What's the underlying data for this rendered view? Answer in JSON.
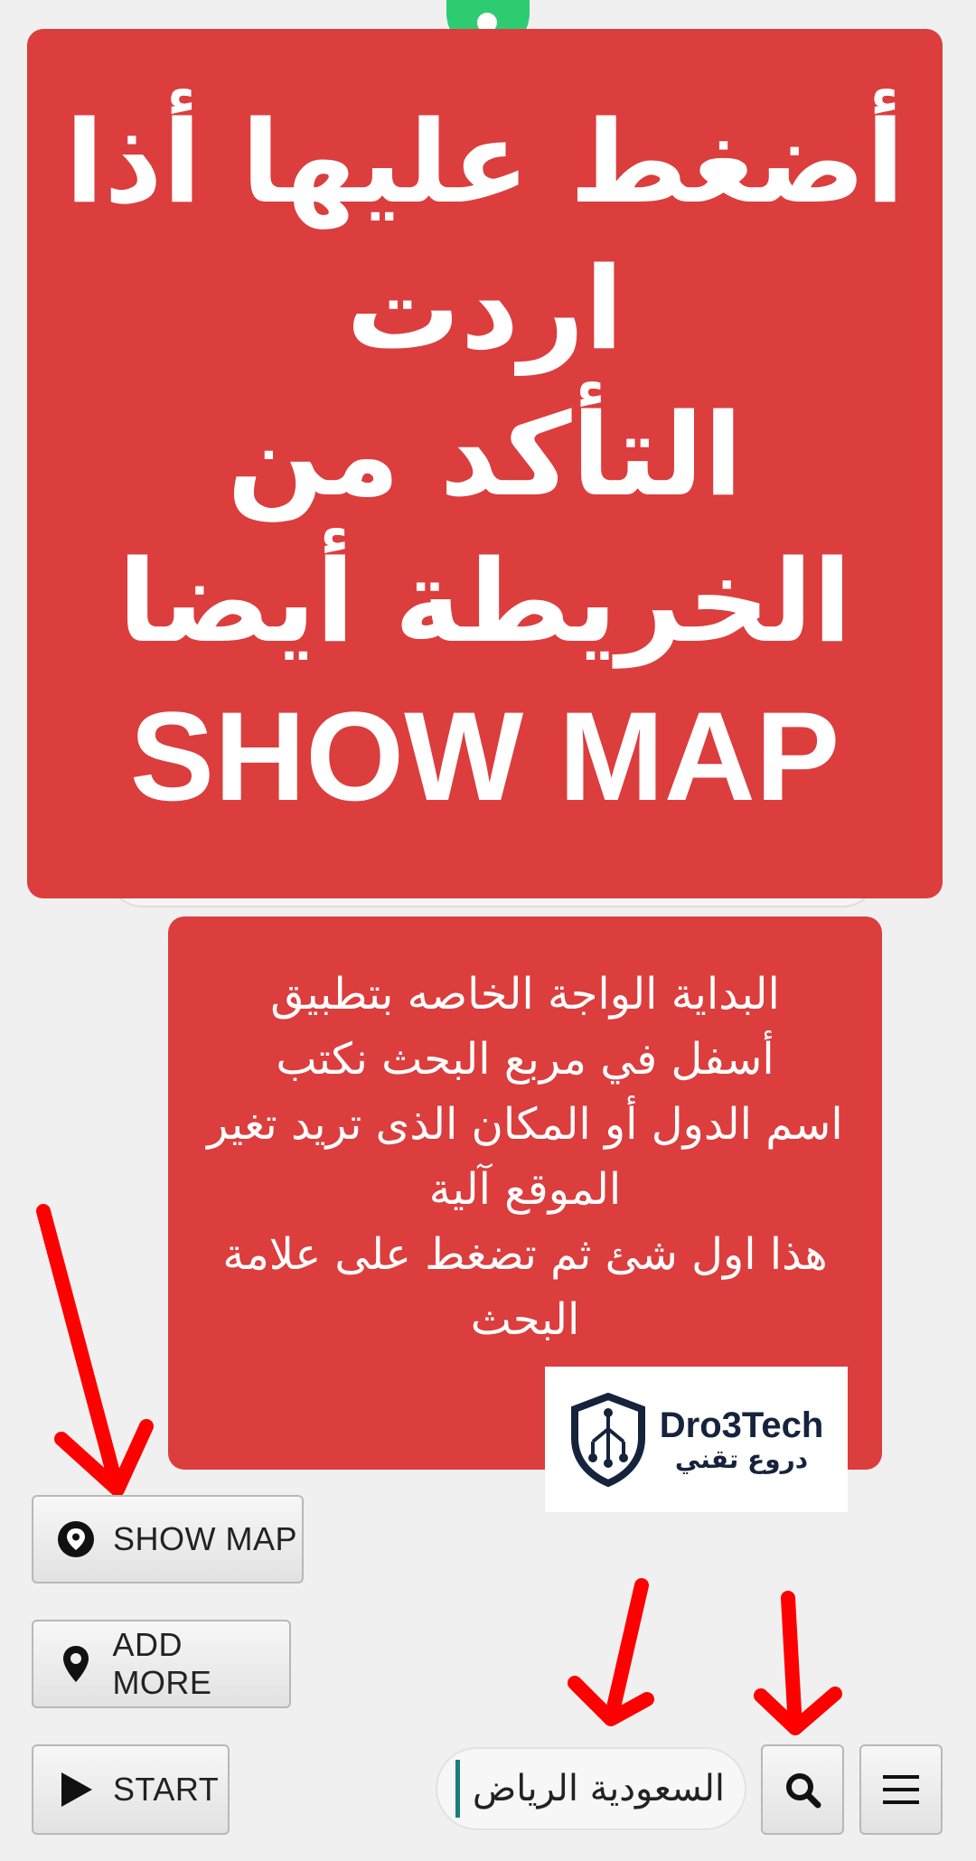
{
  "callout_top": {
    "lines": [
      "أضغط عليها أذا",
      "اردت",
      "التأكد من",
      "الخريطة أيضا",
      "SHOW MAP"
    ]
  },
  "callout_bottom": {
    "lines": [
      "البداية الواجة الخاصه بتطبيق",
      "أسفل في مربع البحث نكتب",
      "اسم الدول أو المكان الذى تريد تغير",
      "الموقع آلية",
      "هذا اول شئ ثم تضغط على علامة",
      "البحث"
    ]
  },
  "logo": {
    "name_en": "Dro3Tech",
    "name_ar": "دروع تقني"
  },
  "buttons": {
    "show_map": "SHOW MAP",
    "add_more": "ADD MORE",
    "start": "START"
  },
  "search": {
    "value": "السعودية الرياض"
  },
  "colors": {
    "callout": "#dc3d3d",
    "arrow": "#ff0000",
    "logo_text": "#16233d",
    "caret": "#1a7f7a"
  },
  "icons": {
    "show_map": "map-pin-filled-icon",
    "add_more": "map-pin-outline-icon",
    "start": "play-icon",
    "search": "search-icon",
    "menu": "hamburger-menu-icon"
  }
}
